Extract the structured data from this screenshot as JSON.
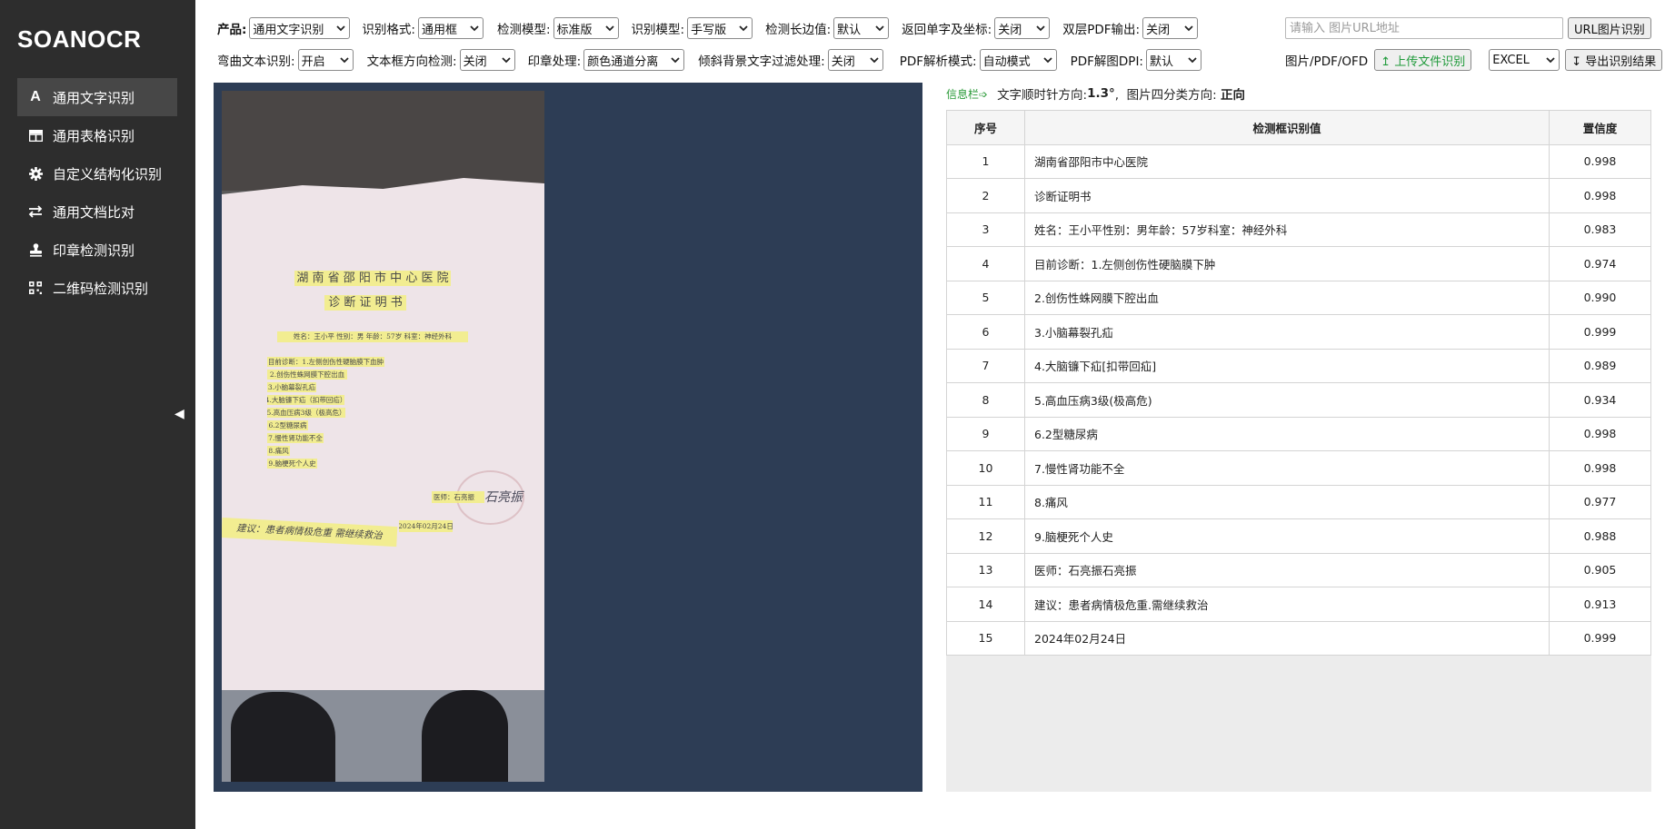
{
  "app": {
    "logo": "SOANOCR",
    "collapse_glyph": "◀"
  },
  "sidebar": {
    "items": [
      {
        "label": "通用文字识别",
        "icon": "font-a-icon"
      },
      {
        "label": "通用表格识别",
        "icon": "table-icon"
      },
      {
        "label": "自定义结构化识别",
        "icon": "gear-icon"
      },
      {
        "label": "通用文档比对",
        "icon": "swap-arrows-icon"
      },
      {
        "label": "印章检测识别",
        "icon": "stamp-icon"
      },
      {
        "label": "二维码检测识别",
        "icon": "qrcode-icon"
      }
    ],
    "active_index": 0
  },
  "toolbar": {
    "row1": [
      {
        "label": "产品:",
        "value": "通用文字识别"
      },
      {
        "label": "识别格式:",
        "value": "通用框"
      },
      {
        "label": "检测模型:",
        "value": "标准版"
      },
      {
        "label": "识别模型:",
        "value": "手写版"
      },
      {
        "label": "检测长边值:",
        "value": "默认"
      },
      {
        "label": "返回单字及坐标:",
        "value": "关闭"
      },
      {
        "label": "双层PDF输出:",
        "value": "关闭"
      }
    ],
    "row2": [
      {
        "label": "弯曲文本识别:",
        "value": "开启"
      },
      {
        "label": "文本框方向检测:",
        "value": "关闭"
      },
      {
        "label": "印章处理:",
        "value": "颜色通道分离"
      },
      {
        "label": "倾斜背景文字过滤处理:",
        "value": "关闭"
      },
      {
        "label": "PDF解析模式:",
        "value": "自动模式"
      },
      {
        "label": "PDF解图DPI:",
        "value": "默认"
      }
    ],
    "url_placeholder": "请输入 图片URL地址",
    "url_button": "URL图片识别",
    "file_types_label": "图片/PDF/OFD",
    "upload_button": "↥ 上传文件识别",
    "export_format": "EXCEL",
    "export_button": "↧ 导出识别结果"
  },
  "document": {
    "lines": [
      "湖 南 省 邵 阳 市 中 心 医 院",
      "诊 断 证 明 书",
      "姓名：王小平   性别：男   年龄：57岁   科室：神经外科",
      "目前诊断：1.左侧创伤性硬脑膜下血肿",
      "2.创伤性蛛网膜下腔出血",
      "3.小脑幕裂孔疝",
      "4.大脑镰下疝（扣带回疝）",
      "5.高血压病3级（极高危）",
      "6.2型糖尿病",
      "7.慢性肾功能不全",
      "8.痛风",
      "9.脑梗死个人史",
      "医师：石亮振",
      "建议：患者病情极危重 需继续救治",
      "2024年02月24日"
    ],
    "signature": "石亮振"
  },
  "info": {
    "tag": "信息栏➩",
    "text1": "文字顺时针方向: ",
    "angle": "1.3°",
    "text2": ",  图片四分类方向: ",
    "orientation": "正向"
  },
  "table": {
    "headers": [
      "序号",
      "检测框识别值",
      "置信度"
    ],
    "rows": [
      [
        "1",
        "湖南省邵阳市中心医院",
        "0.998"
      ],
      [
        "2",
        "诊断证明书",
        "0.998"
      ],
      [
        "3",
        "姓名：王小平性别：男年龄：57岁科室：神经外科",
        "0.983"
      ],
      [
        "4",
        "目前诊断：1.左侧创伤性硬脑膜下肿",
        "0.974"
      ],
      [
        "5",
        "2.创伤性蛛网膜下腔出血",
        "0.990"
      ],
      [
        "6",
        "3.小脑幕裂孔疝",
        "0.999"
      ],
      [
        "7",
        "4.大脑镰下疝[扣带回疝]",
        "0.989"
      ],
      [
        "8",
        "5.高血压病3级(极高危)",
        "0.934"
      ],
      [
        "9",
        "6.2型糖尿病",
        "0.998"
      ],
      [
        "10",
        "7.慢性肾功能不全",
        "0.998"
      ],
      [
        "11",
        "8.痛风",
        "0.977"
      ],
      [
        "12",
        "9.脑梗死个人史",
        "0.988"
      ],
      [
        "13",
        "医师：石亮振石亮振",
        "0.905"
      ],
      [
        "14",
        "建议：患者病情极危重.需继续救治",
        "0.913"
      ],
      [
        "15",
        "2024年02月24日",
        "0.999"
      ]
    ]
  }
}
